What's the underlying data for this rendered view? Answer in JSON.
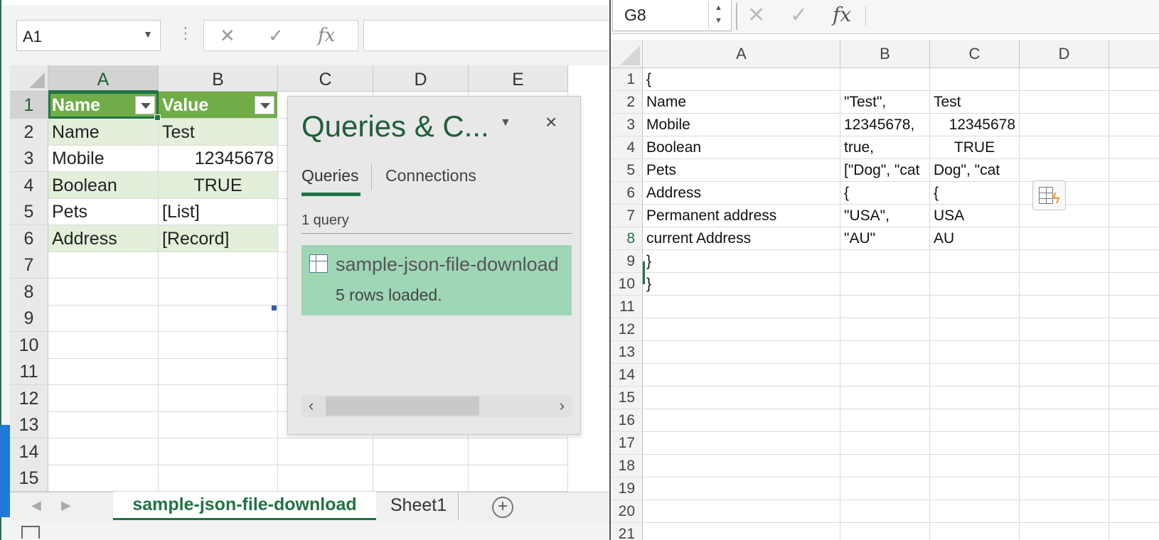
{
  "left_window": {
    "name_box": "A1",
    "fx_icon": "fx",
    "cancel_icon": "✕",
    "enter_icon": "✓",
    "columns": [
      "A",
      "B",
      "C",
      "D",
      "E"
    ],
    "rows": [
      "1",
      "2",
      "3",
      "4",
      "5",
      "6",
      "7",
      "8",
      "9",
      "10",
      "11",
      "12",
      "13",
      "14",
      "15"
    ],
    "table": {
      "headers": [
        "Name",
        "Value"
      ],
      "rows": [
        [
          "Name",
          "Test"
        ],
        [
          "Mobile",
          "12345678"
        ],
        [
          "Boolean",
          "TRUE"
        ],
        [
          "Pets",
          "[List]"
        ],
        [
          "Address",
          "[Record]"
        ]
      ]
    },
    "queries_pane": {
      "title": "Queries & C...",
      "tab_queries": "Queries",
      "tab_connections": "Connections",
      "count": "1 query",
      "query_name": "sample-json-file-download",
      "query_status": "5 rows loaded.",
      "close_icon": "×"
    },
    "sheet_tabs": [
      "sample-json-file-download",
      "Sheet1"
    ],
    "active_tab": "sample-json-file-download",
    "add_sheet": "+"
  },
  "right_window": {
    "name_box": "G8",
    "fx_icon": "fx",
    "cancel_icon": "✕",
    "enter_icon": "✓",
    "columns": [
      "A",
      "B",
      "C",
      "D"
    ],
    "rows": [
      "1",
      "2",
      "3",
      "4",
      "5",
      "6",
      "7",
      "8",
      "9",
      "10",
      "11",
      "12",
      "13",
      "14",
      "15",
      "16",
      "17",
      "18",
      "19",
      "20",
      "21"
    ],
    "cells": [
      [
        "{",
        "",
        ""
      ],
      [
        "Name",
        "\"Test\",",
        "Test"
      ],
      [
        "Mobile",
        "12345678,",
        "12345678"
      ],
      [
        "Boolean",
        "true,",
        "TRUE"
      ],
      [
        "Pets",
        "[\"Dog\", \"cat",
        "Dog\", \"cat"
      ],
      [
        "Address",
        "{",
        "{"
      ],
      [
        "Permanent address",
        "\"USA\",",
        "USA"
      ],
      [
        "current Address",
        "\"AU\"",
        "AU"
      ],
      [
        "}",
        "",
        ""
      ],
      [
        "}",
        "",
        ""
      ]
    ],
    "flash_fill_icon": "flash-fill-icon"
  },
  "colors": {
    "excel_green": "#217346",
    "table_header": "#70ad47",
    "table_band": "#e2efda",
    "query_item_bg": "#9fd6b6"
  }
}
